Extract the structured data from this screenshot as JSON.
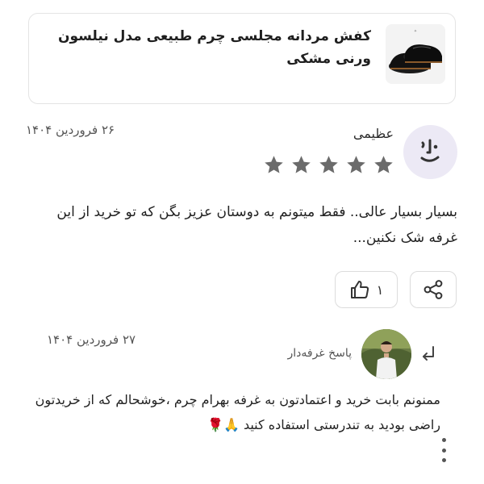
{
  "product": {
    "title": "کفش مردانه مجلسی چرم طبیعی مدل نیلسون ورنی مشکی",
    "image_icon": "shoe-thumbnail"
  },
  "review": {
    "reviewer_name": "عظیمی",
    "date": "۲۶ فروردین ۱۴۰۴",
    "rating": 5,
    "rating_max": 5,
    "text": "بسیار بسیار عالی.. فقط میتونم به دوستان عزیز بگن که تو خرید از این غرفه شک نکنین...",
    "like_count": "۱",
    "share_icon": "share-icon",
    "like_icon": "thumbs-up-icon"
  },
  "reply": {
    "label": "پاسخ غرفه‌دار",
    "date": "۲۷ فروردین ۱۴۰۴",
    "text": "ممنونم بابت خرید و اعتمادتون به غرفه بهرام چرم ،خوشحالم که از خریدتون راضی بودید به تندرستی استفاده کنید 🙏🌹",
    "arrow_icon": "reply-arrow-icon"
  },
  "colors": {
    "star": "#6b6b6b",
    "avatar_bg": "#ece9f5",
    "border": "#dcdcdc"
  }
}
